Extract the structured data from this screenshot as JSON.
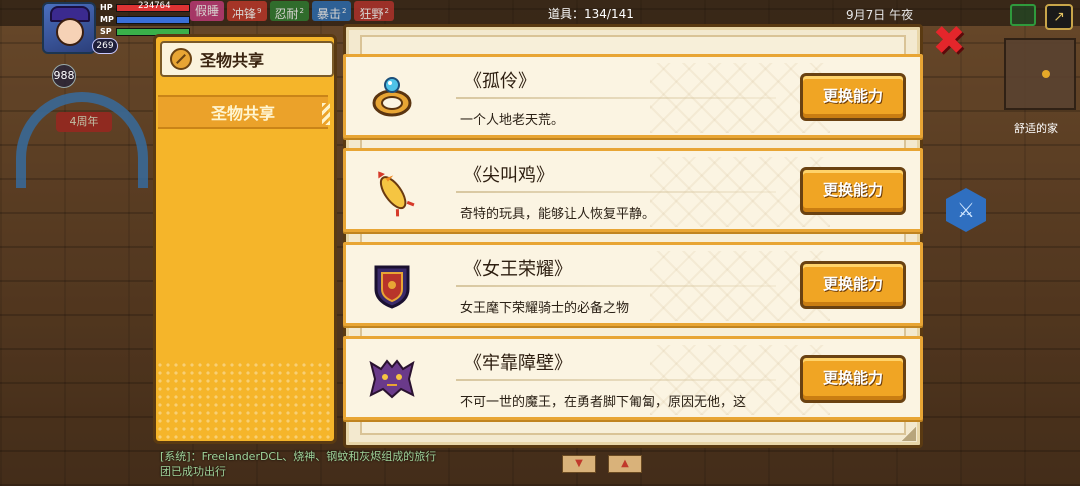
{
  "hud": {
    "hp_label": "HP",
    "mp_label": "MP",
    "sp_label": "SP",
    "hp_value": "234764",
    "level": "269",
    "coins": "988",
    "skill_tags": [
      {
        "label": "假睡",
        "color": "#c23b7a"
      },
      {
        "label": "冲锋",
        "count": "9",
        "color": "#c0392b"
      },
      {
        "label": "忍耐",
        "count": "2",
        "color": "#2f7d32"
      },
      {
        "label": "暴击",
        "count": "2",
        "color": "#2c6fb5"
      },
      {
        "label": "狂野",
        "count": "2",
        "color": "#b5332c"
      }
    ],
    "items_label": "道具：",
    "items_count": "134/141",
    "date": "9月7日 午夜",
    "home_label": "舒适的家",
    "arch_label": "4周年"
  },
  "chat": {
    "line1": "[系统]：FreelanderDCL、烧神、钢蚊和灰烬组成的旅行",
    "line2": "团已成功出行"
  },
  "sidebar": {
    "header_title": "圣物共享",
    "tab_label": "圣物共享"
  },
  "relics": [
    {
      "name": "《孤伶》",
      "desc": "一个人地老天荒。",
      "icon": "ring-icon",
      "button": "更换能力"
    },
    {
      "name": "《尖叫鸡》",
      "desc": "奇特的玩具，能够让人恢复平静。",
      "icon": "screaming-chicken-icon",
      "button": "更换能力"
    },
    {
      "name": "《女王荣耀》",
      "desc": "女王麾下荣耀骑士的必备之物",
      "icon": "shield-icon",
      "button": "更换能力"
    },
    {
      "name": "《牢靠障壁》",
      "desc": "不可一世的魔王，在勇者脚下匍匐，原因无他，这",
      "icon": "demon-armor-icon",
      "button": "更换能力"
    }
  ],
  "colors": {
    "accent": "#f5b52a",
    "panel": "#f3e9cf",
    "close": "#e4262b"
  }
}
